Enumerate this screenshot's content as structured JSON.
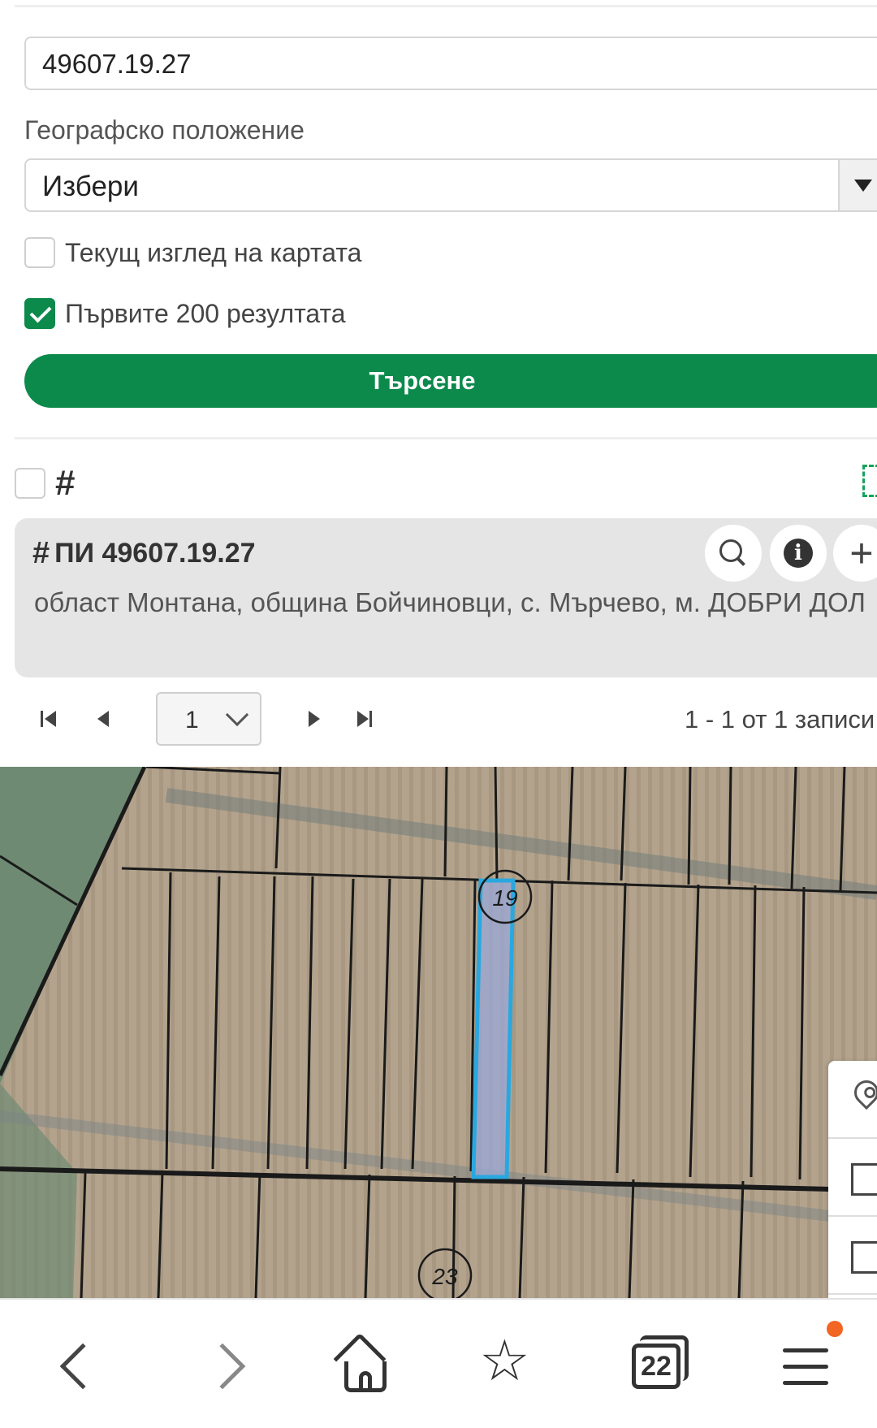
{
  "search": {
    "query_value": "49607.19.27",
    "location_label": "Географско положение",
    "location_selected": "Избери",
    "current_view_label": "Текущ изглед на картата",
    "current_view_checked": false,
    "first200_label": "Първите 200 резултата",
    "first200_checked": true,
    "search_button": "Търсене"
  },
  "results": {
    "select_all_checked": false,
    "items": [
      {
        "title": "ПИ 49607.19.27",
        "address": "област Монтана, община Бойчиновци, с. Мърчево, м. ДОБРИ ДОЛ"
      }
    ],
    "pager": {
      "page": "1",
      "summary": "1 - 1 от 1 записи"
    }
  },
  "map": {
    "labels": [
      "19",
      "23"
    ],
    "highlight_color": "#29a8e0"
  },
  "bottom_nav": {
    "tabs_count": "22"
  },
  "colors": {
    "accent": "#0b8a4b",
    "notification": "#f26522"
  }
}
